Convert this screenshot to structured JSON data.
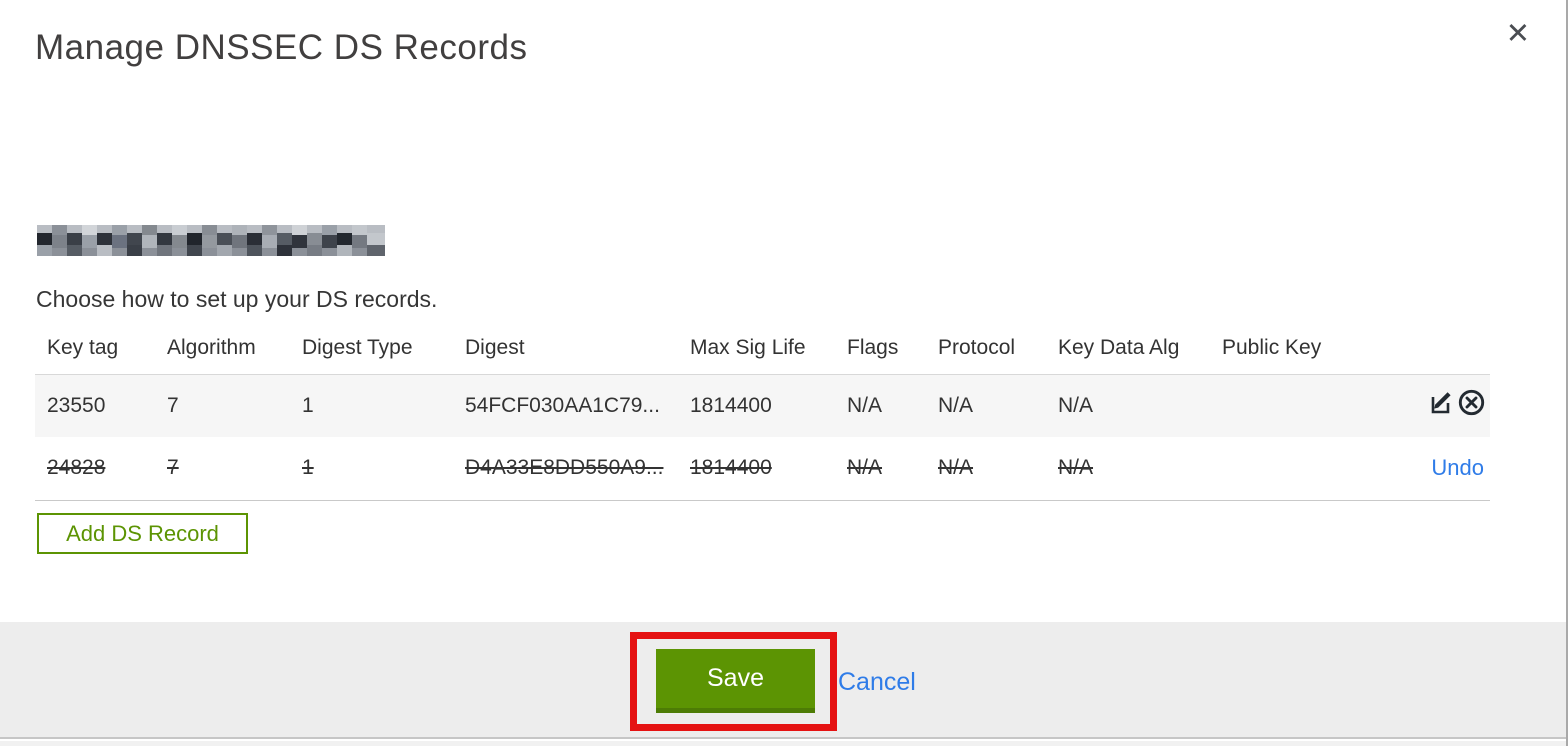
{
  "modal": {
    "title": "Manage DNSSEC DS Records",
    "close_glyph": "✕",
    "subtitle": "Choose how to set up your DS records.",
    "domain_name_redacted": true,
    "add_button_label": "Add DS Record",
    "save_label": "Save",
    "cancel_label": "Cancel"
  },
  "table": {
    "columns": {
      "key_tag": "Key tag",
      "algorithm": "Algorithm",
      "digest_type": "Digest Type",
      "digest": "Digest",
      "max_sig_life": "Max Sig Life",
      "flags": "Flags",
      "protocol": "Protocol",
      "key_data_alg": "Key Data Alg",
      "public_key": "Public Key"
    },
    "rows": [
      {
        "key_tag": "23550",
        "algorithm": "7",
        "digest_type": "1",
        "digest": "54FCF030AA1C79...",
        "max_sig_life": "1814400",
        "flags": "N/A",
        "protocol": "N/A",
        "key_data_alg": "N/A",
        "public_key": "",
        "state": "normal"
      },
      {
        "key_tag": "24828",
        "algorithm": "7",
        "digest_type": "1",
        "digest": "D4A33E8DD550A9...",
        "max_sig_life": "1814400",
        "flags": "N/A",
        "protocol": "N/A",
        "key_data_alg": "N/A",
        "public_key": "",
        "state": "deleted",
        "undo_label": "Undo"
      }
    ]
  },
  "icons": {
    "close": "x-icon",
    "edit": "pencil-square-icon",
    "delete": "circle-x-icon"
  },
  "colors": {
    "accent_green": "#5c9403",
    "green_button_shadow": "#4d7c05",
    "link_blue": "#2f7ce8",
    "annotation_red": "#e51212",
    "row_alt_bg": "#f6f6f6",
    "footer_bg": "#ededed",
    "table_text": "#333333",
    "title_text": "#413f3f"
  }
}
